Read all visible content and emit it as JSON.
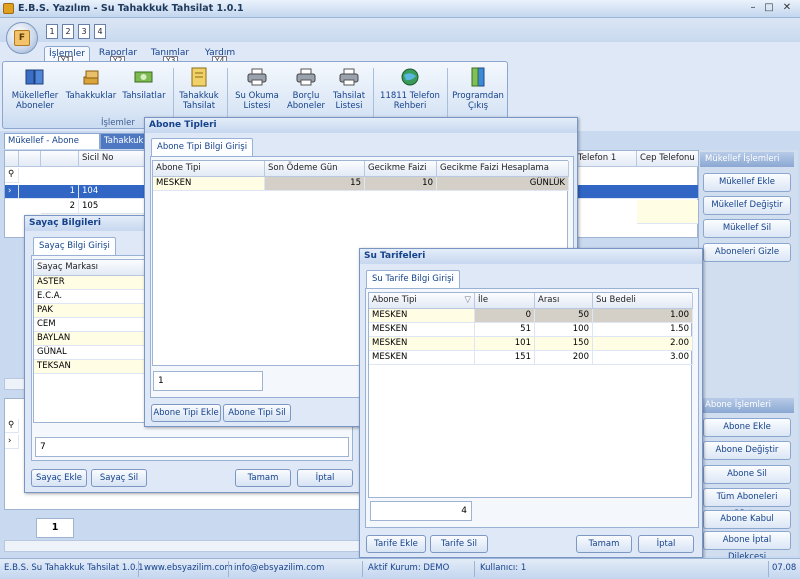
{
  "app": {
    "title": "E.B.S. Yazılım - Su Tahakkuk Tahsilat 1.0.1"
  },
  "qat": [
    "1",
    "2",
    "3",
    "4"
  ],
  "ribbon_tabs": [
    {
      "label": "İşlemler",
      "key": "Y1"
    },
    {
      "label": "Raporlar",
      "key": "Y2"
    },
    {
      "label": "Tanımlar",
      "key": "Y3"
    },
    {
      "label": "Yardım",
      "key": "Y4"
    }
  ],
  "ribbon_buttons": [
    {
      "label": "Mükellefler Aboneler",
      "icon": "book-icon"
    },
    {
      "label": "Tahakkuklar",
      "icon": "stack-icon"
    },
    {
      "label": "Tahsilatlar",
      "icon": "money-icon"
    },
    {
      "label": "Tahakkuk Tahsilat",
      "icon": "notebook-icon"
    },
    {
      "label": "Su Okuma Listesi",
      "icon": "printer-icon"
    },
    {
      "label": "Borçlu Aboneler",
      "icon": "printer-icon"
    },
    {
      "label": "Tahsilat Listesi",
      "icon": "printer-icon"
    },
    {
      "label": "11811 Telefon Rehberi",
      "icon": "globe-icon"
    },
    {
      "label": "Programdan Çıkış",
      "icon": "exit-door-icon"
    }
  ],
  "ribbon_group": "İşlemler",
  "doc_tabs": [
    "Mükellef - Abone Listesi",
    "Tahakkuk L"
  ],
  "main_grid": {
    "headers": [
      "Sicil No",
      "Telefon 1",
      "Cep Telefonu"
    ],
    "rows": [
      {
        "n": "1",
        "sicil": "104"
      },
      {
        "n": "2",
        "sicil": "105"
      }
    ]
  },
  "pager": "1",
  "side_panel": {
    "mukellef_header": "Mükellef İşlemleri",
    "mukellef_buttons": [
      "Mükellef Ekle",
      "Mükellef Değiştir",
      "Mükellef Sil",
      "Aboneleri Gizle"
    ],
    "abone_header": "Abone İşlemleri",
    "abone_buttons": [
      "Abone Ekle",
      "Abone Değiştir",
      "Abone Sil",
      "Tüm Aboneleri Göster",
      "Abone Kabul Dilekçesi",
      "Abone İptal Dilekçesi"
    ]
  },
  "sayac": {
    "title": "Sayaç Bilgileri",
    "tab": "Sayaç Bilgi Girişi",
    "header": "Sayaç Markası",
    "items": [
      "ASTER",
      "E.C.A.",
      "PAK",
      "CEM",
      "BAYLAN",
      "GÜNAL",
      "TEKSAN"
    ],
    "count": "7",
    "buttons": {
      "add": "Sayaç Ekle",
      "delete": "Sayaç Sil",
      "ok": "Tamam",
      "cancel": "İptal"
    }
  },
  "abone_tipleri": {
    "title": "Abone Tipleri",
    "tab": "Abone Tipi Bilgi Girişi",
    "headers": [
      "Abone Tipi",
      "Son Ödeme Gün Sayısı",
      "Gecikme Faizi %",
      "Gecikme Faizi Hesaplama"
    ],
    "rows": [
      {
        "tip": "MESKEN",
        "gun": "15",
        "faiz": "10",
        "hesap": "GÜNLÜK"
      }
    ],
    "count": "1",
    "buttons": {
      "add": "Abone Tipi Ekle",
      "delete": "Abone Tipi Sil"
    }
  },
  "su_tarifeleri": {
    "title": "Su Tarifeleri",
    "tab": "Su Tarife Bilgi Girişi",
    "headers": [
      "Abone Tipi",
      "İle",
      "Arası",
      "Su Bedeli"
    ],
    "rows": [
      {
        "tip": "MESKEN",
        "ile": "0",
        "arasi": "50",
        "bedel": "1.00"
      },
      {
        "tip": "MESKEN",
        "ile": "51",
        "arasi": "100",
        "bedel": "1.50"
      },
      {
        "tip": "MESKEN",
        "ile": "101",
        "arasi": "150",
        "bedel": "2.00"
      },
      {
        "tip": "MESKEN",
        "ile": "151",
        "arasi": "200",
        "bedel": "3.00"
      }
    ],
    "count": "4",
    "buttons": {
      "add": "Tarife Ekle",
      "delete": "Tarife Sil",
      "ok": "Tamam",
      "cancel": "İptal"
    }
  },
  "status": {
    "app": "E.B.S. Su Tahakkuk Tahsilat 1.0.1",
    "web": "www.ebsyazilim.com",
    "email": "info@ebsyazilim.com",
    "kurum": "Aktif Kurum: DEMO",
    "user": "Kullanıcı: 1",
    "time": "07.08"
  }
}
